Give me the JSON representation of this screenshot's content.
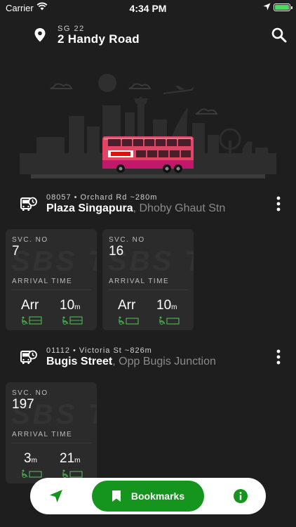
{
  "status_bar": {
    "carrier": "Carrier",
    "time": "4:34 PM"
  },
  "header": {
    "location_code": "SG 22",
    "address": "2 Handy Road",
    "icons": {
      "pin": "location-pin-icon",
      "search": "search-icon"
    }
  },
  "stops": [
    {
      "meta": "08057 • Orchard Rd ~280m",
      "name": "Plaza Singapura",
      "subtitle": ", Dhoby Ghaut Stn",
      "services": [
        {
          "svc_label": "SVC. NO",
          "number": "7",
          "arrival_label": "ARRIVAL TIME",
          "watermark": "SBS Tr",
          "eta1": "Arr",
          "eta1_unit": "",
          "eta2": "10",
          "eta2_unit": "m"
        },
        {
          "svc_label": "SVC. NO",
          "number": "16",
          "arrival_label": "ARRIVAL TIME",
          "watermark": "SBS Tr",
          "eta1": "Arr",
          "eta1_unit": "",
          "eta2": "10",
          "eta2_unit": "m"
        }
      ]
    },
    {
      "meta": "01112 • Victoria St ~826m",
      "name": "Bugis Street",
      "subtitle": ", Opp Bugis Junction",
      "services": [
        {
          "svc_label": "SVC. NO",
          "number": "197",
          "arrival_label": "ARRIVAL TIME",
          "watermark": "SBS Tr",
          "eta1": "3",
          "eta1_unit": "m",
          "eta2": "21",
          "eta2_unit": "m"
        }
      ]
    }
  ],
  "bottom_bar": {
    "bookmarks_label": "Bookmarks",
    "accent_color": "#15951e"
  }
}
